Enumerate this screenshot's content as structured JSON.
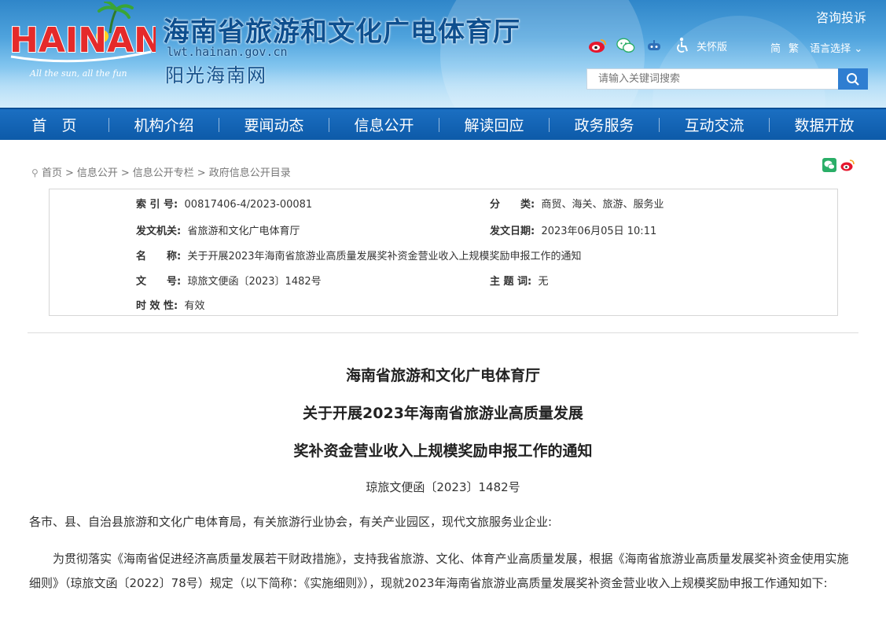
{
  "header": {
    "logo_text": "HAINAN",
    "logo_tagline": "All the sun, all the fun",
    "site_title": "海南省旅游和文化广电体育厅",
    "site_domain": "lwt.hainan.gov.cn",
    "site_slogan": "阳光海南网",
    "consult_link": "咨询投诉",
    "accessibility_label": "关怀版",
    "lang_simplified": "简",
    "lang_traditional": "繁",
    "lang_select": "语言选择",
    "search_placeholder": "请输入关键词搜索"
  },
  "nav": {
    "items": [
      "首　页",
      "机构介绍",
      "要闻动态",
      "信息公开",
      "解读回应",
      "政务服务",
      "互动交流",
      "数据开放"
    ]
  },
  "breadcrumb": {
    "items": [
      "首页",
      "信息公开",
      "信息公开专栏",
      "政府信息公开目录"
    ],
    "separator": ">"
  },
  "meta": {
    "index_label": "索 引 号:",
    "index_value": "00817406-4/2023-00081",
    "category_label": "分　　类:",
    "category_value": "商贸、海关、旅游、服务业",
    "issuer_label": "发文机关:",
    "issuer_value": "省旅游和文化广电体育厅",
    "date_label": "发文日期:",
    "date_value": "2023年06月05日 10:11",
    "name_label": "名　　称:",
    "name_value": "关于开展2023年海南省旅游业高质量发展奖补资金营业收入上规模奖励申报工作的通知",
    "docno_label": "文　　号:",
    "docno_value": "琼旅文便函〔2023〕1482号",
    "keyword_label": "主 题 词:",
    "keyword_value": "无",
    "validity_label": "时 效 性:",
    "validity_value": "有效"
  },
  "article": {
    "title_line1": "海南省旅游和文化广电体育厅",
    "title_line2": "关于开展2023年海南省旅游业高质量发展",
    "title_line3": "奖补资金营业收入上规模奖励申报工作的通知",
    "doc_number": "琼旅文便函〔2023〕1482号",
    "salutation": "各市、县、自治县旅游和文化广电体育局，有关旅游行业协会，有关产业园区，现代文旅服务业企业:",
    "paragraph1": "为贯彻落实《海南省促进经济高质量发展若干财政措施》，支持我省旅游、文化、体育产业高质量发展，根据《海南省旅游业高质量发展奖补资金使用实施细则》（琼旅文函〔2022〕78号）规定（以下简称：《实施细则》），现就2023年海南省旅游业高质量发展奖补资金营业收入上规模奖励申报工作通知如下:"
  },
  "colors": {
    "nav_blue": "#0d5aa8",
    "title_blue": "#0e4f8f",
    "search_button": "#2f7ed1"
  }
}
